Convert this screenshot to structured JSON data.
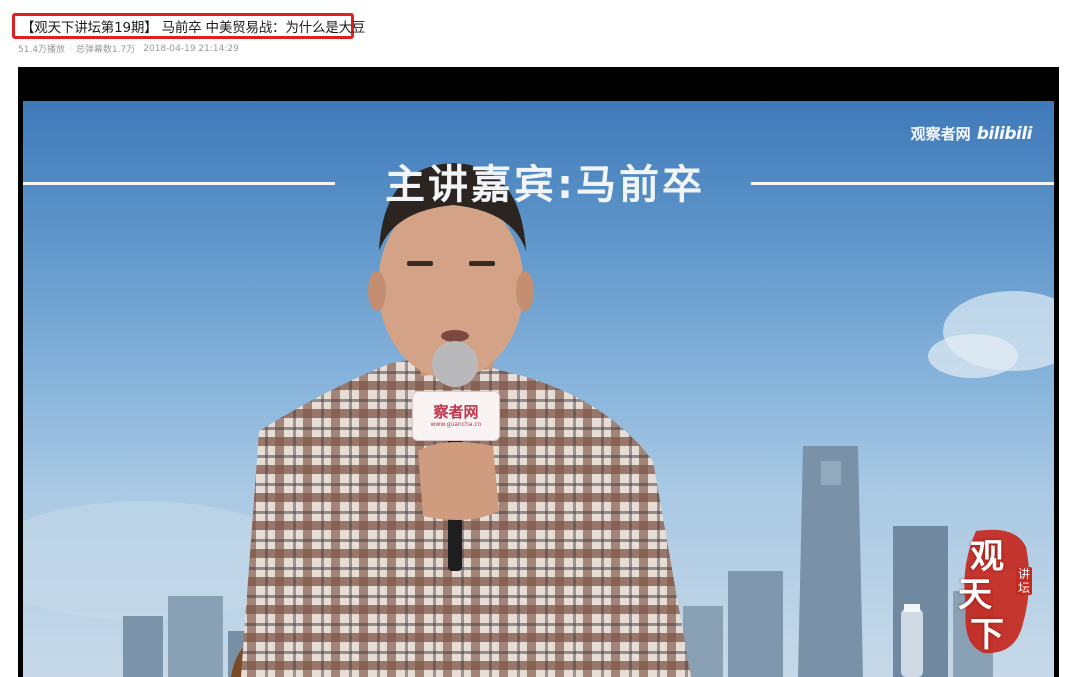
{
  "header": {
    "title": "【观天下讲坛第19期】 马前卒 中美贸易战：为什么是大豆",
    "views": "51.4万播放",
    "danmaku": "总弹幕数1.7万",
    "date": "2018-04-19 21:14:29"
  },
  "video": {
    "banner_text": "主讲嘉宾:马前卒",
    "watermark_site": "观察者网",
    "watermark_brand": "bilibili",
    "mic_brand": "察者网",
    "mic_url": "www.guancha.cn",
    "corner_glyph_1": "观",
    "corner_glyph_2": "天",
    "corner_glyph_3": "下",
    "corner_sub": "讲坛"
  },
  "colors": {
    "highlight": "#e02020",
    "sky_top": "#3f79b9",
    "sky_bottom": "#c7d9e8"
  }
}
